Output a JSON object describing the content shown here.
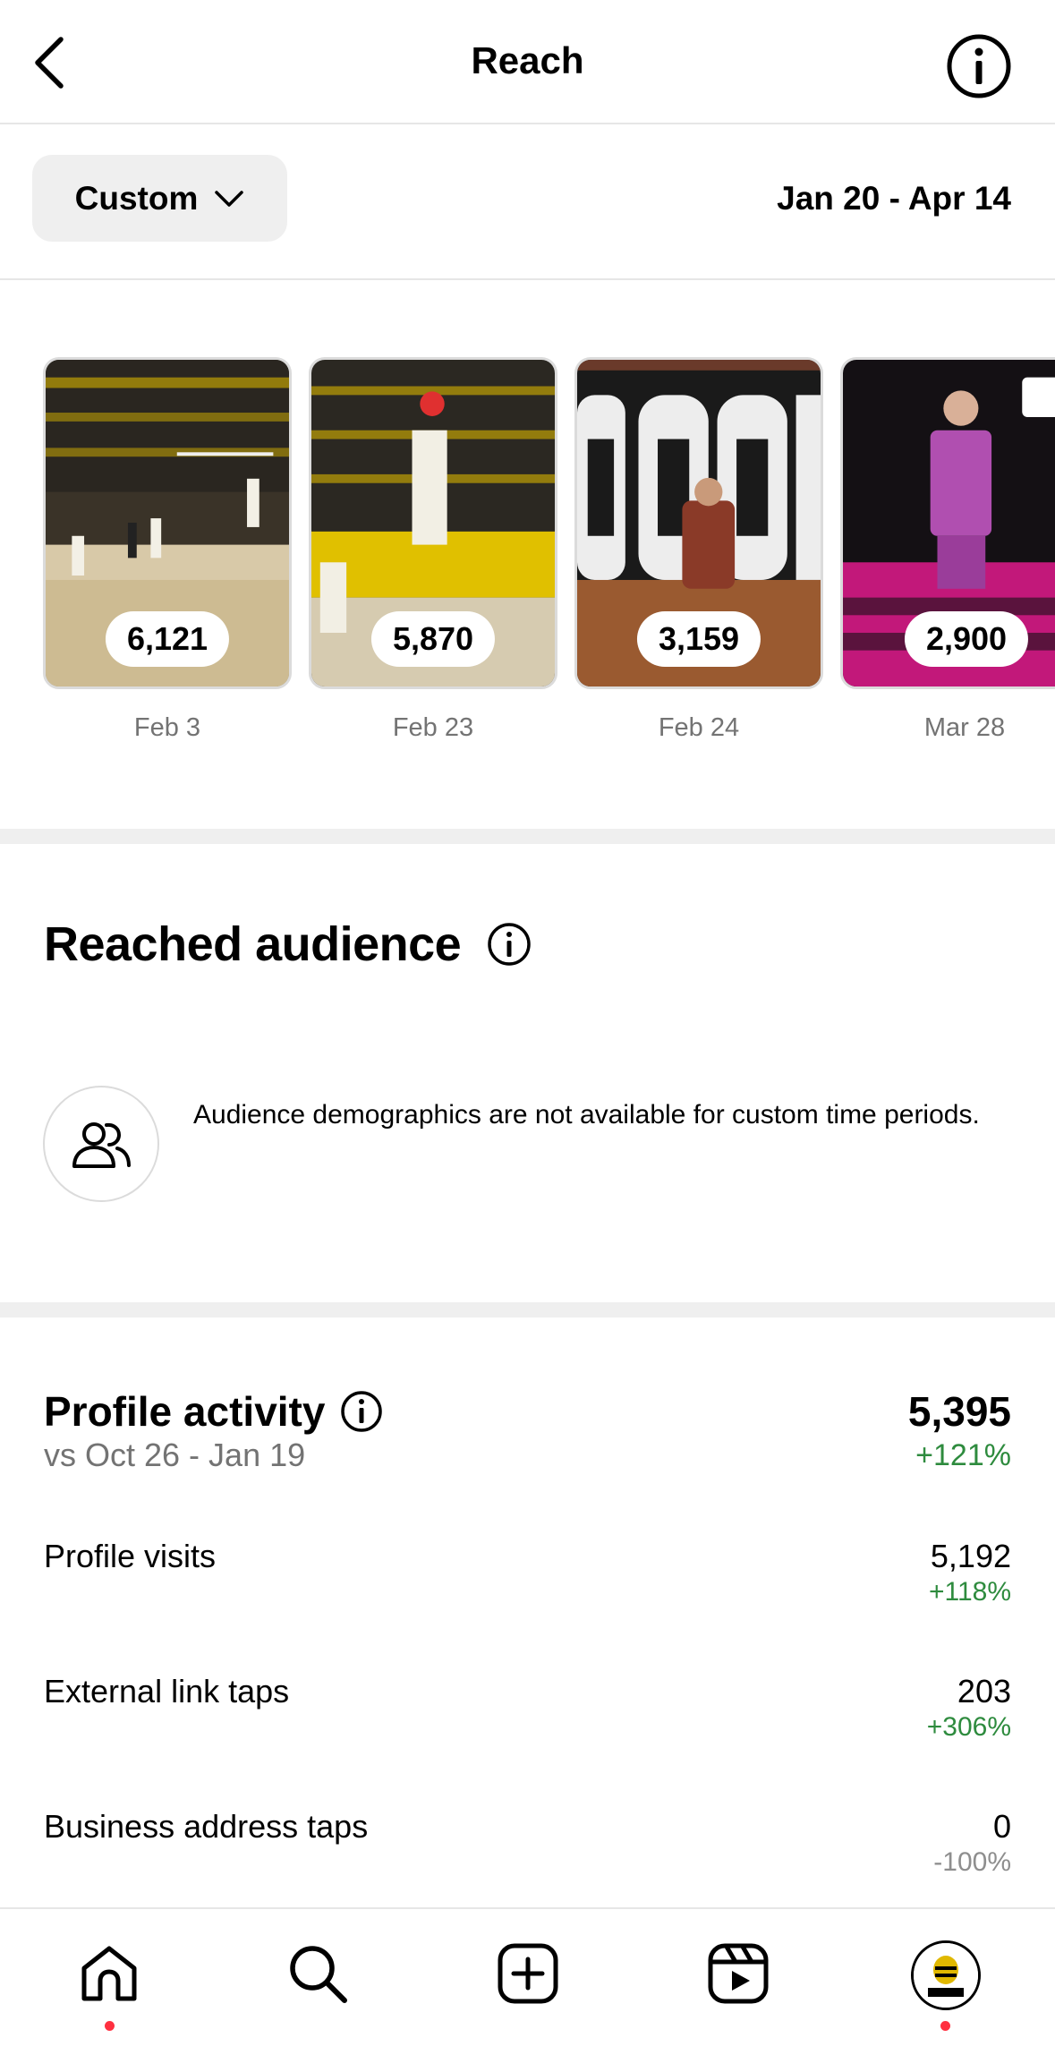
{
  "header": {
    "title": "Reach",
    "back_icon": "chevron-left-icon",
    "info_icon": "info-icon"
  },
  "filter": {
    "period_label": "Custom",
    "dropdown_icon": "chevron-down-icon",
    "date_range": "Jan 20 - Apr 14"
  },
  "posts": [
    {
      "reach": "6,121",
      "date": "Feb 3"
    },
    {
      "reach": "5,870",
      "date": "Feb 23"
    },
    {
      "reach": "3,159",
      "date": "Feb 24"
    },
    {
      "reach": "2,900",
      "date": "Mar 28"
    }
  ],
  "reached_audience": {
    "title": "Reached audience",
    "icon": "people-icon",
    "message": "Audience demographics are not available for custom time periods."
  },
  "profile_activity": {
    "title": "Profile activity",
    "comparison": "vs Oct 26 - Jan 19",
    "total": "5,395",
    "total_change": "+121%",
    "rows": [
      {
        "label": "Profile visits",
        "value": "5,192",
        "change": "+118%"
      },
      {
        "label": "External link taps",
        "value": "203",
        "change": "+306%"
      },
      {
        "label": "Business address taps",
        "value": "0",
        "change": "-100%"
      }
    ]
  },
  "colors": {
    "positive": "#2e8b3e",
    "negative": "#8e8e8e",
    "notification_dot": "#ff3040"
  },
  "bottom_nav": {
    "items": [
      "home-icon",
      "search-icon",
      "create-icon",
      "reels-icon",
      "profile-avatar"
    ]
  }
}
